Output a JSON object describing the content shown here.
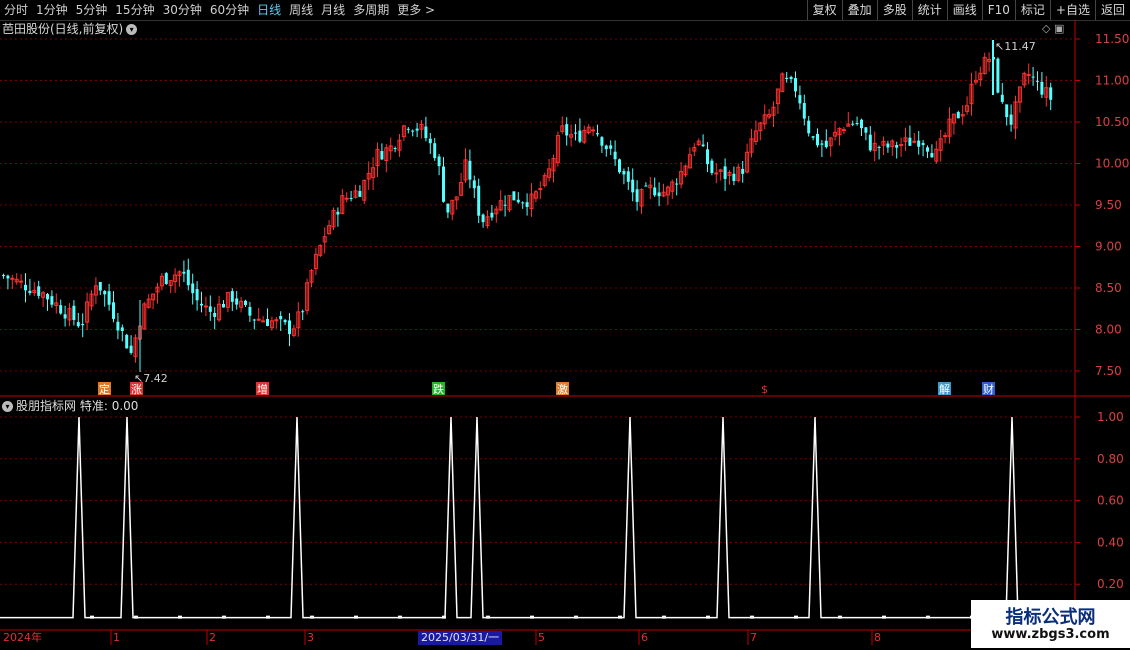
{
  "toolbar": {
    "periods": [
      "分时",
      "1分钟",
      "5分钟",
      "15分钟",
      "30分钟",
      "60分钟",
      "日线",
      "周线",
      "月线",
      "多周期",
      "更多 >"
    ],
    "active_period": "日线",
    "right_buttons": [
      "复权",
      "叠加",
      "多股",
      "统计",
      "画线",
      "F10",
      "标记",
      "+自选",
      "返回"
    ]
  },
  "main": {
    "title": "芭田股份(日线,前复权)",
    "price_axis": [
      "11.50",
      "11.00",
      "10.50",
      "10.00",
      "9.50",
      "9.00",
      "8.50",
      "8.00",
      "7.50"
    ],
    "high_marker": "11.47",
    "low_marker": "7.42",
    "event_labels": [
      {
        "text": "定",
        "color": "#e07a2a"
      },
      {
        "text": "涨",
        "color": "#e03030"
      },
      {
        "text": "增",
        "color": "#e03030"
      },
      {
        "text": "跌",
        "color": "#2ab32a"
      },
      {
        "text": "激",
        "color": "#e07a2a"
      },
      {
        "text": "$",
        "color": "#e03030"
      },
      {
        "text": "解",
        "color": "#3a9ad0"
      },
      {
        "text": "财",
        "color": "#3060d0"
      }
    ]
  },
  "indicator": {
    "title": "股朋指标网",
    "value_label": "特准: 0.00",
    "axis": [
      "1.00",
      "0.80",
      "0.60",
      "0.40",
      "0.20"
    ]
  },
  "date_bar": {
    "labels": [
      "2024年",
      "1",
      "2",
      "3",
      "5",
      "6",
      "7",
      "8"
    ],
    "selected": "2025/03/31/一"
  },
  "watermark": {
    "line1": "指标公式网",
    "line2": "www.zbgs3.com"
  },
  "colors": {
    "up": "#ff3030",
    "down": "#54ffff",
    "grid": "#7a0000",
    "axis": "#c00000"
  }
}
